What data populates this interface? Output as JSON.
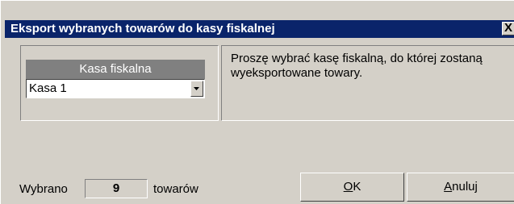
{
  "window": {
    "title": "Eksport wybranych towarów do kasy fiskalnej",
    "close_label": "X"
  },
  "kasa": {
    "header": "Kasa fiskalna",
    "selected": "Kasa 1"
  },
  "info": {
    "text": "Proszę wybrać kasę fiskalną, do której zostaną wyeksportowane towary."
  },
  "footer": {
    "wybrano_label": "Wybrano",
    "count": "9",
    "towarow_label": "towarów"
  },
  "buttons": {
    "ok_mnemonic": "O",
    "ok_rest": "K",
    "cancel_mnemonic": "A",
    "cancel_rest": "nuluj"
  },
  "colors": {
    "titlebar": "#0a246a",
    "face": "#d4d0c8",
    "header_gray": "#808080"
  },
  "icons": {
    "close": "close-icon",
    "dropdown": "chevron-down-icon"
  }
}
